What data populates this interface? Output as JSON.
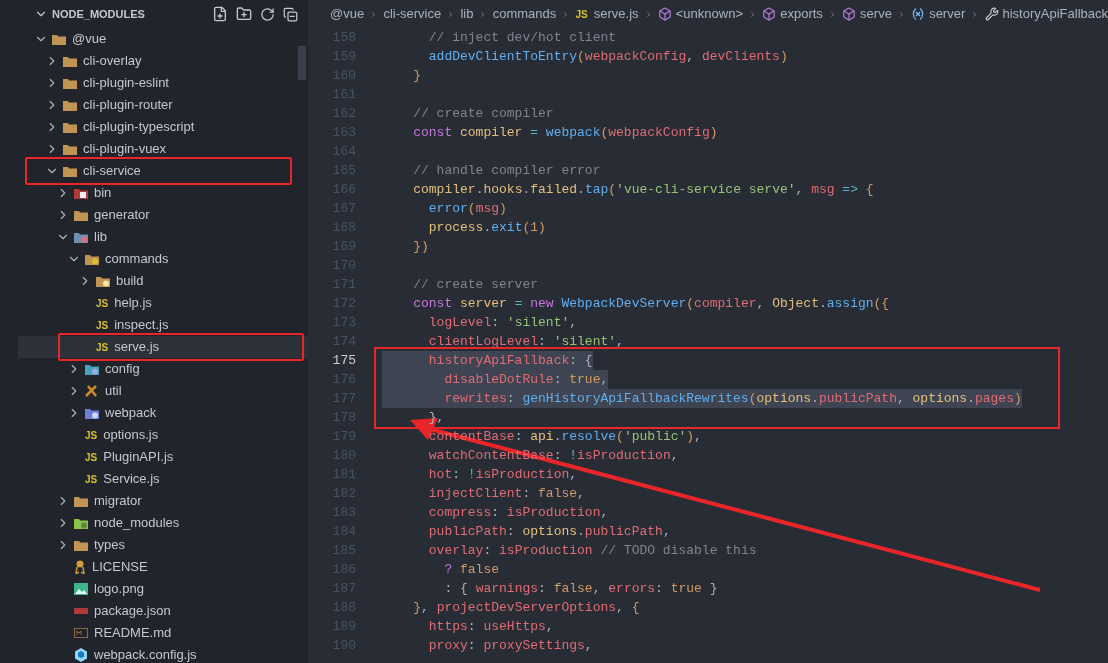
{
  "explorer": {
    "title": "NODE_MODULES",
    "expanded": true
  },
  "tree": [
    {
      "label": "@vue",
      "kind": "folder",
      "expanded": true,
      "selected": false,
      "children": [
        {
          "label": "cli-overlay",
          "kind": "folder",
          "expanded": false,
          "selected": false
        },
        {
          "label": "cli-plugin-eslint",
          "kind": "folder",
          "expanded": false,
          "selected": false
        },
        {
          "label": "cli-plugin-router",
          "kind": "folder",
          "expanded": false,
          "selected": false
        },
        {
          "label": "cli-plugin-typescript",
          "kind": "folder",
          "expanded": false,
          "selected": false
        },
        {
          "label": "cli-plugin-vuex",
          "kind": "folder",
          "expanded": false,
          "selected": false
        },
        {
          "label": "cli-service",
          "kind": "folder",
          "expanded": true,
          "selected": false,
          "annotated": true,
          "children": [
            {
              "label": "bin",
              "kind": "bin",
              "expanded": false,
              "selected": false
            },
            {
              "label": "generator",
              "kind": "folder",
              "expanded": false,
              "selected": false
            },
            {
              "label": "lib",
              "kind": "lib",
              "expanded": true,
              "selected": false,
              "children": [
                {
                  "label": "commands",
                  "kind": "commands",
                  "expanded": true,
                  "selected": false,
                  "children": [
                    {
                      "label": "build",
                      "kind": "build",
                      "expanded": false,
                      "selected": false
                    },
                    {
                      "label": "help.js",
                      "kind": "js",
                      "badge": "JS",
                      "selected": false
                    },
                    {
                      "label": "inspect.js",
                      "kind": "js",
                      "badge": "JS",
                      "selected": false
                    },
                    {
                      "label": "serve.js",
                      "kind": "js",
                      "badge": "JS",
                      "selected": true,
                      "annotated": true
                    }
                  ]
                },
                {
                  "label": "config",
                  "kind": "config",
                  "expanded": false,
                  "selected": false
                },
                {
                  "label": "util",
                  "kind": "util",
                  "expanded": false,
                  "selected": false
                },
                {
                  "label": "webpack",
                  "kind": "webpackdir",
                  "expanded": false,
                  "selected": false
                },
                {
                  "label": "options.js",
                  "kind": "js",
                  "badge": "JS",
                  "selected": false
                },
                {
                  "label": "PluginAPI.js",
                  "kind": "js",
                  "badge": "JS",
                  "selected": false
                },
                {
                  "label": "Service.js",
                  "kind": "js",
                  "badge": "JS",
                  "selected": false
                }
              ]
            },
            {
              "label": "migrator",
              "kind": "folder",
              "expanded": false,
              "selected": false
            },
            {
              "label": "node_modules",
              "kind": "nodedir",
              "expanded": false,
              "selected": false
            },
            {
              "label": "types",
              "kind": "folder",
              "expanded": false,
              "selected": false
            },
            {
              "label": "LICENSE",
              "kind": "license",
              "selected": false
            },
            {
              "label": "logo.png",
              "kind": "image",
              "selected": false
            },
            {
              "label": "package.json",
              "kind": "npm",
              "selected": false
            },
            {
              "label": "README.md",
              "kind": "md",
              "selected": false
            },
            {
              "label": "webpack.config.js",
              "kind": "webpack",
              "selected": false
            }
          ]
        }
      ]
    }
  ],
  "breadcrumb": [
    {
      "label": "@vue"
    },
    {
      "label": "cli-service"
    },
    {
      "label": "lib"
    },
    {
      "label": "commands"
    },
    {
      "label": "serve.js",
      "kind": "js",
      "badge": "JS"
    },
    {
      "label": "<unknown>",
      "kind": "cube"
    },
    {
      "label": "exports",
      "kind": "cube"
    },
    {
      "label": "serve",
      "kind": "cube"
    },
    {
      "label": "server",
      "kind": "variable"
    },
    {
      "label": "historyApiFallback",
      "kind": "wrench"
    }
  ],
  "code": [
    {
      "lines": [
        {
          "no": "158",
          "current": false,
          "tokens": [
            {
              "kind": "comment",
              "text": "      // inject dev/hot client"
            }
          ]
        },
        {
          "no": "159",
          "current": false,
          "tokens": [
            {
              "kind": "function",
              "text": "      addDevClientToEntry"
            },
            {
              "kind": "bracket",
              "text": "("
            },
            {
              "kind": "variable",
              "text": "webpackConfig"
            },
            {
              "kind": "punct",
              "text": ", "
            },
            {
              "kind": "variable",
              "text": "devClients"
            },
            {
              "kind": "bracket",
              "text": ")"
            }
          ]
        },
        {
          "no": "160",
          "current": false,
          "tokens": [
            {
              "kind": "bracket",
              "text": "    }"
            }
          ]
        },
        {
          "no": "161",
          "current": false
        },
        {
          "no": "162",
          "current": false,
          "tokens": [
            {
              "kind": "comment",
              "text": "    // create compiler"
            }
          ]
        },
        {
          "no": "163",
          "current": false,
          "tokens": [
            {
              "kind": "keyword",
              "text": "    const "
            },
            {
              "kind": "object",
              "text": "compiler"
            },
            {
              "kind": "operator",
              "text": " = "
            },
            {
              "kind": "function",
              "text": "webpack"
            },
            {
              "kind": "bracket",
              "text": "("
            },
            {
              "kind": "variable",
              "text": "webpackConfig"
            },
            {
              "kind": "bracket",
              "text": ")"
            }
          ]
        },
        {
          "no": "164",
          "current": false
        },
        {
          "no": "165",
          "current": false,
          "tokens": [
            {
              "kind": "comment",
              "text": "    // handle compiler error"
            }
          ]
        },
        {
          "no": "166",
          "current": false,
          "tokens": [
            {
              "kind": "object",
              "text": "    compiler"
            },
            {
              "kind": "punct",
              "text": "."
            },
            {
              "kind": "object",
              "text": "hooks"
            },
            {
              "kind": "punct",
              "text": "."
            },
            {
              "kind": "object",
              "text": "failed"
            },
            {
              "kind": "punct",
              "text": "."
            },
            {
              "kind": "function",
              "text": "tap"
            },
            {
              "kind": "bracket",
              "text": "("
            },
            {
              "kind": "string",
              "text": "'vue-cli-service serve'"
            },
            {
              "kind": "punct",
              "text": ", "
            },
            {
              "kind": "variable",
              "text": "msg"
            },
            {
              "kind": "operator",
              "text": " => "
            },
            {
              "kind": "bracket",
              "text": "{"
            }
          ]
        },
        {
          "no": "167",
          "current": false,
          "tokens": [
            {
              "kind": "function",
              "text": "      error"
            },
            {
              "kind": "bracket",
              "text": "("
            },
            {
              "kind": "variable",
              "text": "msg"
            },
            {
              "kind": "bracket",
              "text": ")"
            }
          ]
        },
        {
          "no": "168",
          "current": false,
          "tokens": [
            {
              "kind": "object",
              "text": "      process"
            },
            {
              "kind": "punct",
              "text": "."
            },
            {
              "kind": "function",
              "text": "exit"
            },
            {
              "kind": "bracket",
              "text": "("
            },
            {
              "kind": "number",
              "text": "1"
            },
            {
              "kind": "bracket",
              "text": ")"
            }
          ]
        },
        {
          "no": "169",
          "current": false,
          "tokens": [
            {
              "kind": "bracket",
              "text": "    })"
            }
          ]
        },
        {
          "no": "170",
          "current": false
        },
        {
          "no": "171",
          "current": false,
          "tokens": [
            {
              "kind": "comment",
              "text": "    // create server"
            }
          ]
        },
        {
          "no": "172",
          "current": false,
          "tokens": [
            {
              "kind": "keyword",
              "text": "    const "
            },
            {
              "kind": "object",
              "text": "server"
            },
            {
              "kind": "operator",
              "text": " = "
            },
            {
              "kind": "keyword",
              "text": "new "
            },
            {
              "kind": "function",
              "text": "WebpackDevServer"
            },
            {
              "kind": "bracket",
              "text": "("
            },
            {
              "kind": "variable",
              "text": "compiler"
            },
            {
              "kind": "punct",
              "text": ", "
            },
            {
              "kind": "object",
              "text": "Object"
            },
            {
              "kind": "punct",
              "text": "."
            },
            {
              "kind": "function",
              "text": "assign"
            },
            {
              "kind": "bracket",
              "text": "({"
            }
          ]
        },
        {
          "no": "173",
          "current": false,
          "tokens": [
            {
              "kind": "variable",
              "text": "      logLevel"
            },
            {
              "kind": "punct",
              "text": ": "
            },
            {
              "kind": "string",
              "text": "'silent'"
            },
            {
              "kind": "punct",
              "text": ","
            }
          ]
        },
        {
          "no": "174",
          "current": false,
          "tokens": [
            {
              "kind": "variable",
              "text": "      clientLogLevel"
            },
            {
              "kind": "punct",
              "text": ": "
            },
            {
              "kind": "string",
              "text": "'silent'"
            },
            {
              "kind": "punct",
              "text": ","
            }
          ]
        }
      ]
    },
    {
      "annotated": true,
      "lines": [
        {
          "no": "175",
          "current": true,
          "highlighted": true,
          "tokens": [
            {
              "kind": "variable",
              "text": "      historyApiFallback"
            },
            {
              "kind": "punct",
              "text": ": {"
            }
          ]
        },
        {
          "no": "176",
          "current": false,
          "highlighted": true,
          "tokens": [
            {
              "kind": "variable",
              "text": "        disableDotRule"
            },
            {
              "kind": "punct",
              "text": ": "
            },
            {
              "kind": "number",
              "text": "true"
            },
            {
              "kind": "punct",
              "text": ","
            }
          ]
        },
        {
          "no": "177",
          "current": false,
          "highlighted": true,
          "tokens": [
            {
              "kind": "variable",
              "text": "        rewrites"
            },
            {
              "kind": "punct",
              "text": ": "
            },
            {
              "kind": "function",
              "text": "genHistoryApiFallbackRewrites"
            },
            {
              "kind": "bracket",
              "text": "("
            },
            {
              "kind": "object",
              "text": "options"
            },
            {
              "kind": "punct",
              "text": "."
            },
            {
              "kind": "variable",
              "text": "publicPath"
            },
            {
              "kind": "punct",
              "text": ", "
            },
            {
              "kind": "object",
              "text": "options"
            },
            {
              "kind": "punct",
              "text": "."
            },
            {
              "kind": "variable",
              "text": "pages"
            },
            {
              "kind": "bracket",
              "text": ")"
            }
          ]
        },
        {
          "no": "178",
          "current": false,
          "tokens": [
            {
              "kind": "punct",
              "text": "      },"
            }
          ]
        }
      ]
    },
    {
      "lines": [
        {
          "no": "179",
          "current": false,
          "tokens": [
            {
              "kind": "variable",
              "text": "      contentBase"
            },
            {
              "kind": "punct",
              "text": ": "
            },
            {
              "kind": "object",
              "text": "api"
            },
            {
              "kind": "punct",
              "text": "."
            },
            {
              "kind": "function",
              "text": "resolve"
            },
            {
              "kind": "bracket",
              "text": "("
            },
            {
              "kind": "string",
              "text": "'public'"
            },
            {
              "kind": "bracket",
              "text": ")"
            },
            {
              "kind": "punct",
              "text": ","
            }
          ]
        },
        {
          "no": "180",
          "current": false,
          "tokens": [
            {
              "kind": "variable",
              "text": "      watchContentBase"
            },
            {
              "kind": "punct",
              "text": ": "
            },
            {
              "kind": "operator",
              "text": "!"
            },
            {
              "kind": "variable",
              "text": "isProduction"
            },
            {
              "kind": "punct",
              "text": ","
            }
          ]
        },
        {
          "no": "181",
          "current": false,
          "tokens": [
            {
              "kind": "variable",
              "text": "      hot"
            },
            {
              "kind": "punct",
              "text": ": "
            },
            {
              "kind": "operator",
              "text": "!"
            },
            {
              "kind": "variable",
              "text": "isProduction"
            },
            {
              "kind": "punct",
              "text": ","
            }
          ]
        },
        {
          "no": "182",
          "current": false,
          "tokens": [
            {
              "kind": "variable",
              "text": "      injectClient"
            },
            {
              "kind": "punct",
              "text": ": "
            },
            {
              "kind": "number",
              "text": "false"
            },
            {
              "kind": "punct",
              "text": ","
            }
          ]
        },
        {
          "no": "183",
          "current": false,
          "tokens": [
            {
              "kind": "variable",
              "text": "      compress"
            },
            {
              "kind": "punct",
              "text": ": "
            },
            {
              "kind": "variable",
              "text": "isProduction"
            },
            {
              "kind": "punct",
              "text": ","
            }
          ]
        },
        {
          "no": "184",
          "current": false,
          "tokens": [
            {
              "kind": "variable",
              "text": "      publicPath"
            },
            {
              "kind": "punct",
              "text": ": "
            },
            {
              "kind": "object",
              "text": "options"
            },
            {
              "kind": "punct",
              "text": "."
            },
            {
              "kind": "variable",
              "text": "publicPath"
            },
            {
              "kind": "punct",
              "text": ","
            }
          ]
        },
        {
          "no": "185",
          "current": false,
          "tokens": [
            {
              "kind": "variable",
              "text": "      overlay"
            },
            {
              "kind": "punct",
              "text": ": "
            },
            {
              "kind": "variable",
              "text": "isProduction"
            },
            {
              "kind": "comment",
              "text": " // TODO disable this"
            }
          ]
        },
        {
          "no": "186",
          "current": false,
          "tokens": [
            {
              "kind": "keyword",
              "text": "        ? "
            },
            {
              "kind": "number",
              "text": "false"
            }
          ]
        },
        {
          "no": "187",
          "current": false,
          "tokens": [
            {
              "kind": "punct",
              "text": "        : { "
            },
            {
              "kind": "variable",
              "text": "warnings"
            },
            {
              "kind": "punct",
              "text": ": "
            },
            {
              "kind": "number",
              "text": "false"
            },
            {
              "kind": "punct",
              "text": ", "
            },
            {
              "kind": "variable",
              "text": "errors"
            },
            {
              "kind": "punct",
              "text": ": "
            },
            {
              "kind": "number",
              "text": "true"
            },
            {
              "kind": "punct",
              "text": " }"
            }
          ]
        },
        {
          "no": "188",
          "current": false,
          "tokens": [
            {
              "kind": "bracket",
              "text": "    }"
            },
            {
              "kind": "punct",
              "text": ", "
            },
            {
              "kind": "variable",
              "text": "projectDevServerOptions"
            },
            {
              "kind": "punct",
              "text": ", "
            },
            {
              "kind": "bracket",
              "text": "{"
            }
          ]
        },
        {
          "no": "189",
          "current": false,
          "tokens": [
            {
              "kind": "variable",
              "text": "      https"
            },
            {
              "kind": "punct",
              "text": ": "
            },
            {
              "kind": "variable",
              "text": "useHttps"
            },
            {
              "kind": "punct",
              "text": ","
            }
          ]
        },
        {
          "no": "190",
          "current": false,
          "tokens": [
            {
              "kind": "variable",
              "text": "      proxy"
            },
            {
              "kind": "punct",
              "text": ": "
            },
            {
              "kind": "variable",
              "text": "proxySettings"
            },
            {
              "kind": "punct",
              "text": ","
            }
          ]
        }
      ]
    }
  ]
}
